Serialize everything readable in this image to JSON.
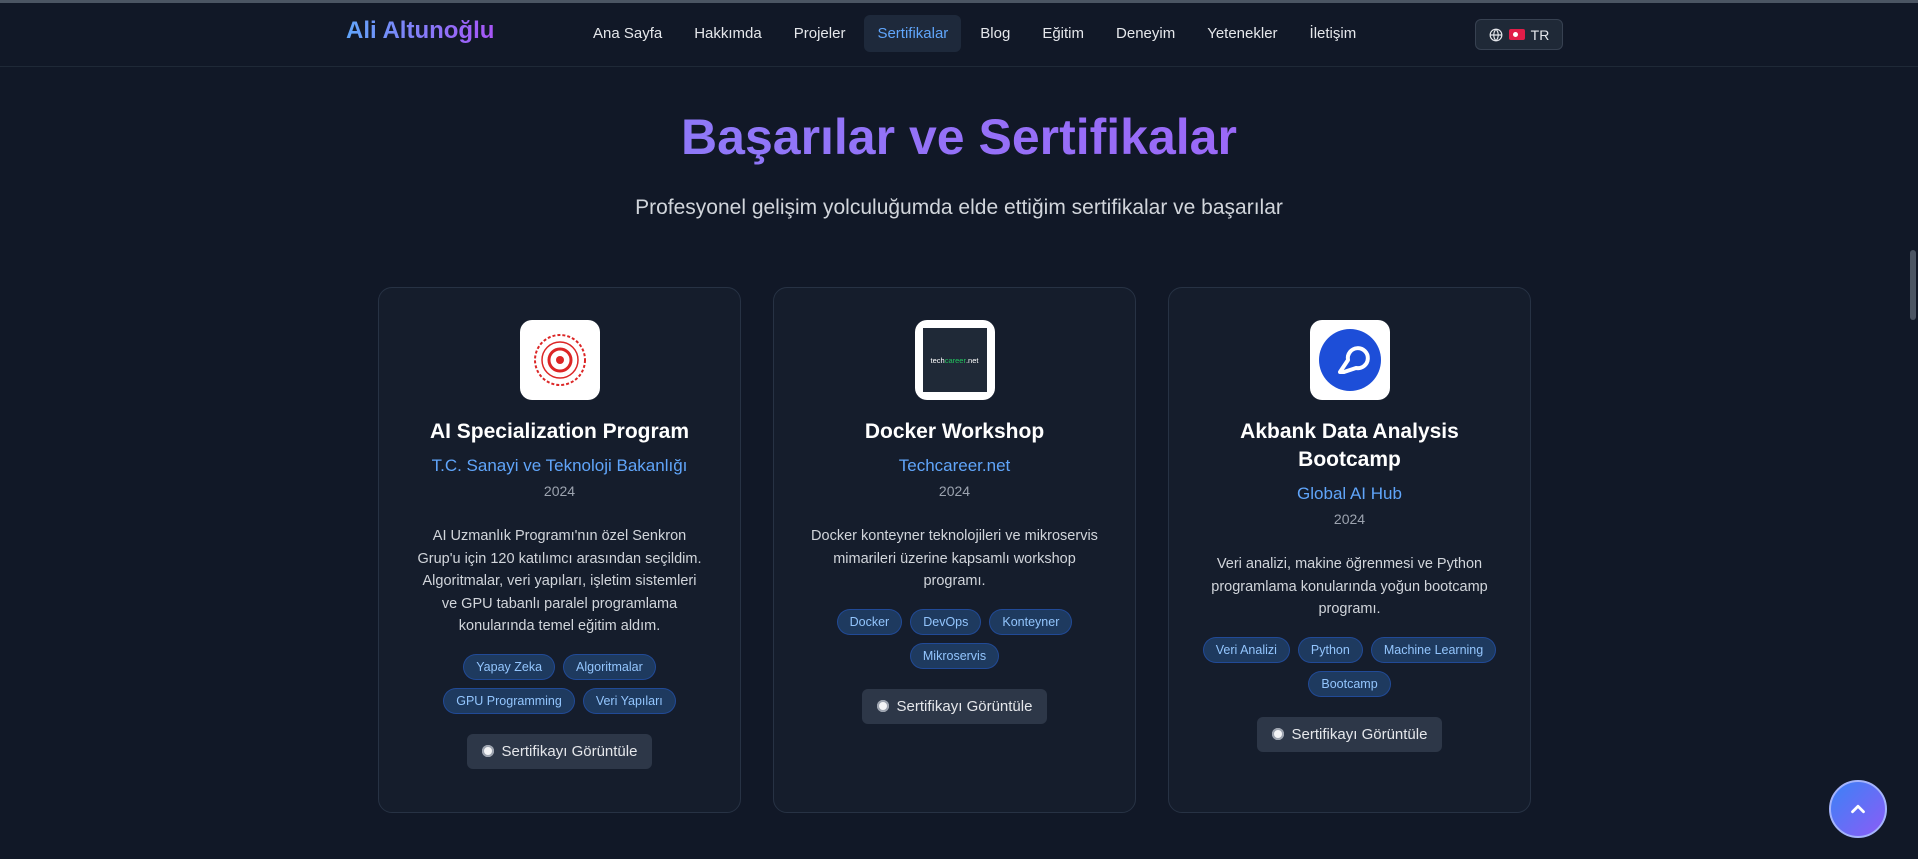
{
  "brand": "Ali Altunoğlu",
  "nav": {
    "items": [
      "Ana Sayfa",
      "Hakkımda",
      "Projeler",
      "Sertifikalar",
      "Blog",
      "Eğitim",
      "Deneyim",
      "Yetenekler",
      "İletişim"
    ],
    "active": "Sertifikalar",
    "lang": "TR"
  },
  "section": {
    "title": "Başarılar ve Sertifikalar",
    "subtitle": "Profesyonel gelişim yolculuğumda elde ettiğim sertifikalar ve başarılar"
  },
  "cards": [
    {
      "title": "AI Specialization Program",
      "issuer": "T.C. Sanayi ve Teknoloji Bakanlığı",
      "year": "2024",
      "desc": "AI Uzmanlık Programı'nın özel Senkron Grup'u için 120 katılımcı arasından seçildim. Algoritmalar, veri yapıları, işletim sistemleri ve GPU tabanlı paralel programlama konularında temel eğitim aldım.",
      "tags": [
        "Yapay Zeka",
        "Algoritmalar",
        "GPU Programming",
        "Veri Yapıları"
      ],
      "button": "Sertifikayı Görüntüle",
      "logo_icon": "ministry-seal-icon"
    },
    {
      "title": "Docker Workshop",
      "issuer": "Techcareer.net",
      "year": "2024",
      "desc": "Docker konteyner teknolojileri ve mikroservis mimarileri üzerine kapsamlı workshop programı.",
      "tags": [
        "Docker",
        "DevOps",
        "Konteyner",
        "Mikroservis"
      ],
      "button": "Sertifikayı Görüntüle",
      "logo_icon": "techcareer-logo-icon"
    },
    {
      "title": "Akbank Data Analysis Bootcamp",
      "issuer": "Global AI Hub",
      "year": "2024",
      "desc": "Veri analizi, makine öğrenmesi ve Python programlama konularında yoğun bootcamp programı.",
      "tags": [
        "Veri Analizi",
        "Python",
        "Machine Learning",
        "Bootcamp"
      ],
      "button": "Sertifikayı Görüntüle",
      "logo_icon": "global-ai-hub-logo-icon"
    }
  ]
}
